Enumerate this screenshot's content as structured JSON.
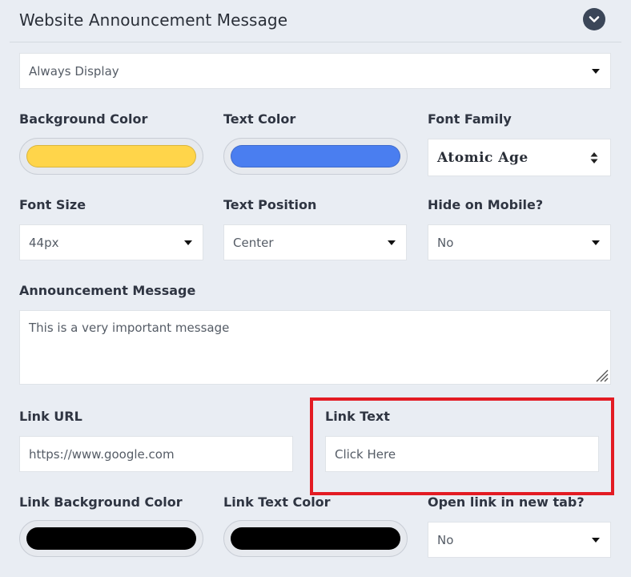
{
  "header": {
    "title": "Website Announcement Message",
    "collapse_icon": "chevron-down-icon"
  },
  "display_mode": {
    "value": "Always Display"
  },
  "background_color": {
    "label": "Background Color",
    "color": "#ffd54a"
  },
  "text_color": {
    "label": "Text Color",
    "color": "#4a7ef0"
  },
  "font_family": {
    "label": "Font Family",
    "value": "Atomic Age"
  },
  "font_size": {
    "label": "Font Size",
    "value": "44px"
  },
  "text_position": {
    "label": "Text Position",
    "value": "Center"
  },
  "hide_on_mobile": {
    "label": "Hide on Mobile?",
    "value": "No"
  },
  "announcement_message": {
    "label": "Announcement Message",
    "value": "This is a very important message"
  },
  "link_url": {
    "label": "Link URL",
    "value": "https://www.google.com"
  },
  "link_text": {
    "label": "Link Text",
    "value": "Click Here"
  },
  "link_background_color": {
    "label": "Link Background Color",
    "color": "#000000"
  },
  "link_text_color": {
    "label": "Link Text Color",
    "color": "#000000"
  },
  "open_new_tab": {
    "label": "Open link in new tab?",
    "value": "No"
  },
  "highlight_color": "#e31b23"
}
